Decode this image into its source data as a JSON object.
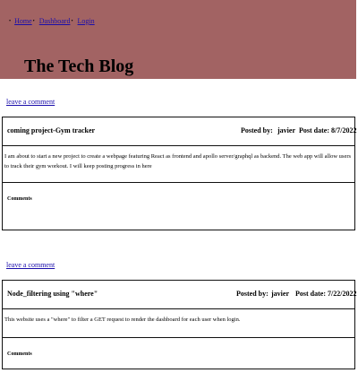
{
  "nav": {
    "items": [
      {
        "label": "Home"
      },
      {
        "label": "Dashboard"
      },
      {
        "label": "Login"
      }
    ]
  },
  "header": {
    "title": "The Tech Blog"
  },
  "posts": [
    {
      "leave_comment_label": "leave a comment",
      "title": "coming project-Gym tracker",
      "posted_by_label": "Posted by:",
      "author": "javier",
      "post_date_label": "Post date:",
      "date": "8/7/2022",
      "body": "I am about to start a new project to create a webpage featuring React as frontend and apollo server/graphql as backend. The web app will allow users to track their gym workout. I will keep posting progress in here",
      "comments_label": "Comments"
    },
    {
      "leave_comment_label": "leave a comment",
      "title": "Node_filtering using \"where\"",
      "posted_by_label": "Posted by:",
      "author": "javier",
      "post_date_label": "Post date:",
      "date": "7/22/2022",
      "body": "This website uses a \"where\" to filter a GET request to render the dashboard for each user when login.",
      "comments_label": "Comments"
    }
  ]
}
